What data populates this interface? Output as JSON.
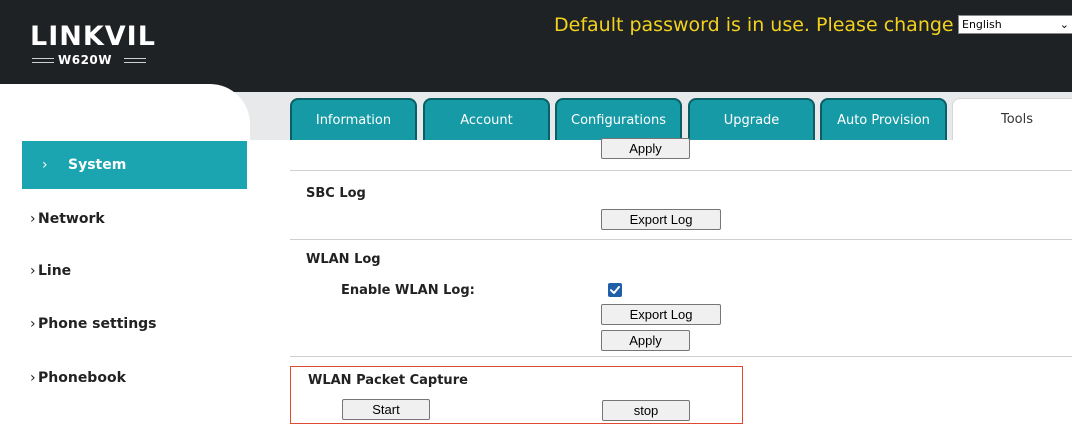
{
  "header": {
    "logo": "LINKVIL",
    "model": "W620W",
    "warning": "Default password is in use. Please change",
    "language": "English"
  },
  "tabs": [
    {
      "label": "Information"
    },
    {
      "label": "Account"
    },
    {
      "label": "Configurations"
    },
    {
      "label": "Upgrade"
    },
    {
      "label": "Auto Provision"
    },
    {
      "label": "Tools",
      "active": true
    }
  ],
  "sidebar": {
    "items": [
      {
        "label": "System",
        "active": true
      },
      {
        "label": "Network"
      },
      {
        "label": "Line"
      },
      {
        "label": "Phone settings"
      },
      {
        "label": "Phonebook"
      }
    ]
  },
  "content": {
    "top_apply": "Apply",
    "sbc_log": {
      "title": "SBC Log",
      "export": "Export Log"
    },
    "wlan_log": {
      "title": "WLAN Log",
      "enable_label": "Enable WLAN Log:",
      "enable_checked": true,
      "export": "Export Log",
      "apply": "Apply"
    },
    "wlan_capture": {
      "title": "WLAN Packet Capture",
      "start": "Start",
      "stop": "stop"
    }
  },
  "colors": {
    "accent": "#1aa5b1",
    "header_bg": "#1f2225",
    "warning": "#f3d21e",
    "highlight_border": "#e04a31"
  }
}
